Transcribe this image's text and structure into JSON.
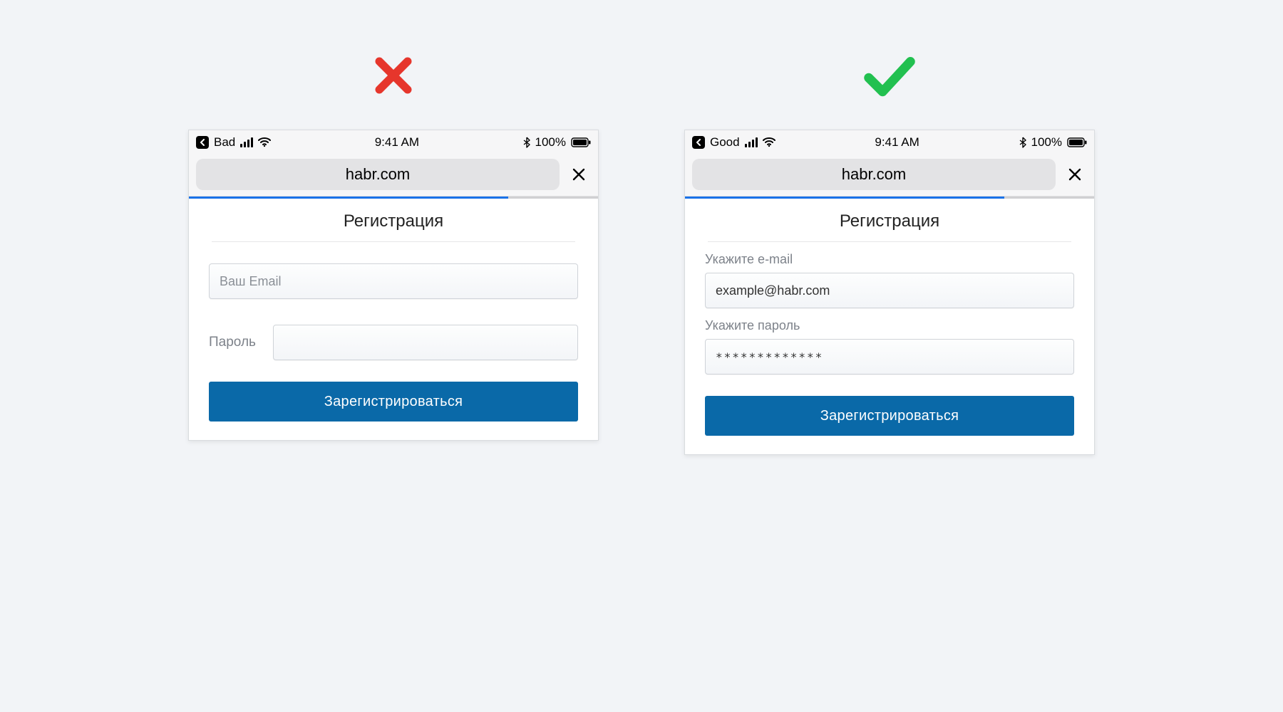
{
  "colors": {
    "accent": "#0a69a8",
    "progress": "#1a72e8",
    "bad": "#e6362c",
    "good": "#22c050"
  },
  "statusbar": {
    "time": "9:41 AM",
    "battery_pct": "100%"
  },
  "address": {
    "domain": "habr.com"
  },
  "bad": {
    "verdict_icon": "cross-icon",
    "back_label": "Bad",
    "title": "Регистрация",
    "email_placeholder": "Ваш Email",
    "password_label": "Пароль",
    "submit_label": "Зарегистрироваться"
  },
  "good": {
    "verdict_icon": "check-icon",
    "back_label": "Good",
    "title": "Регистрация",
    "email_label": "Укажите e-mail",
    "email_value": "example@habr.com",
    "password_label": "Укажите пароль",
    "password_value": "*************",
    "submit_label": "Зарегистрироваться"
  }
}
